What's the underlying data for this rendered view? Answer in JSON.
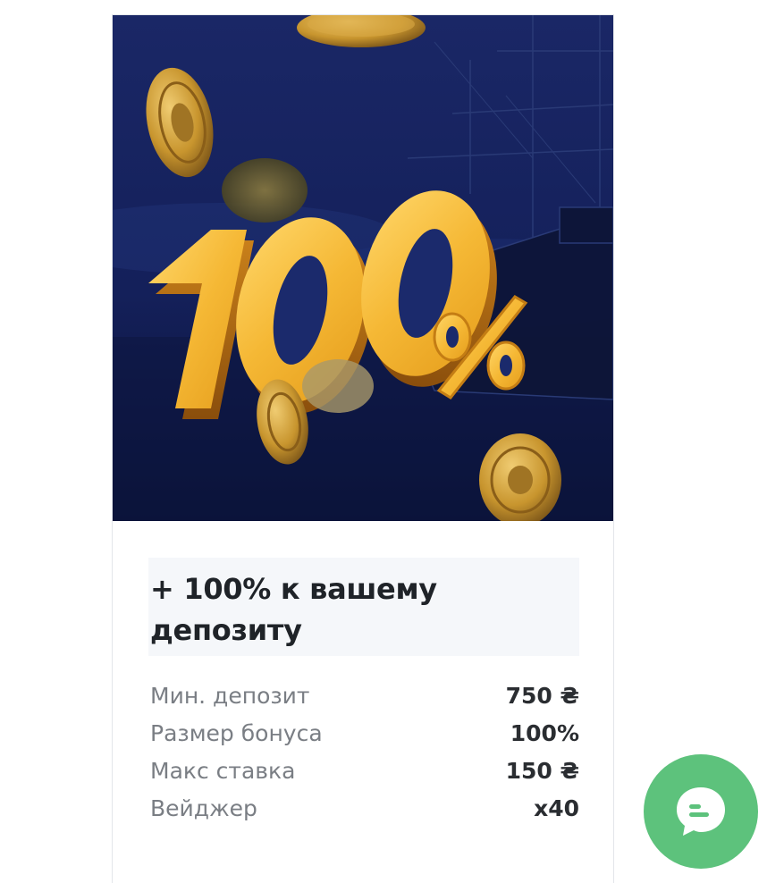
{
  "banner": {
    "headline_graphic": "100%",
    "icon": "coins-ship-banner-image"
  },
  "offer": {
    "title": "+ 100% к вашему депозиту",
    "rows": [
      {
        "label": "Мин. депозит",
        "value": "750 ₴"
      },
      {
        "label": "Размер бонуса",
        "value": "100%"
      },
      {
        "label": "Макс ставка",
        "value": "150 ₴"
      },
      {
        "label": "Вейджер",
        "value": "x40"
      }
    ]
  },
  "chat": {
    "icon": "chat-bubble-icon",
    "color": "#5dc27c"
  },
  "colors": {
    "banner_bg": "#15215a",
    "gold": "#f2b73a",
    "title_bg": "#f5f7fa"
  }
}
